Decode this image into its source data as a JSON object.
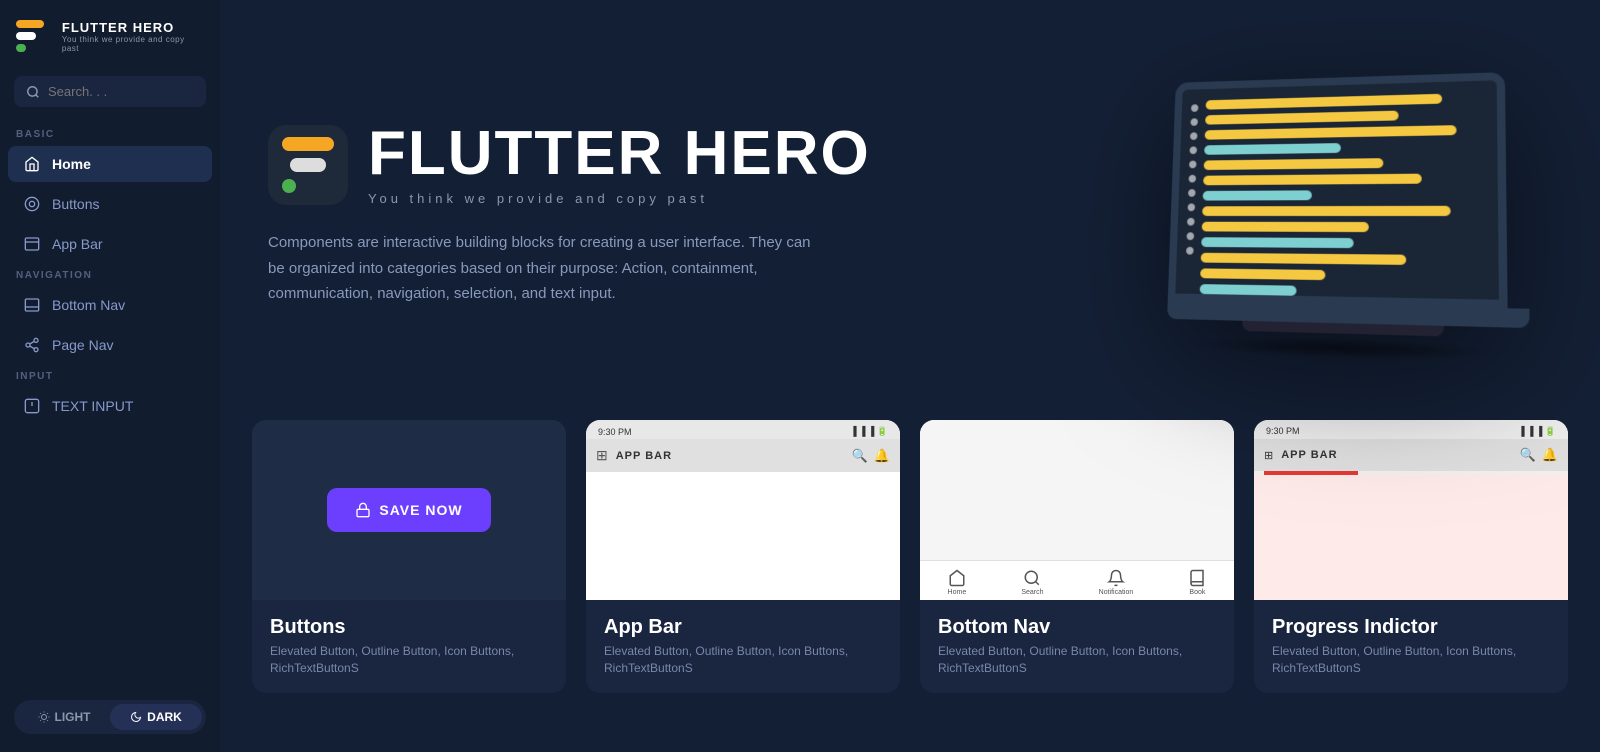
{
  "sidebar": {
    "logo": {
      "title": "FLUTTER HERO",
      "subtitle": "You think we provide and copy past"
    },
    "search": {
      "placeholder": "Search. . ."
    },
    "sections": [
      {
        "label": "BASIC",
        "items": [
          {
            "id": "home",
            "label": "Home",
            "icon": "home-icon",
            "active": true
          },
          {
            "id": "buttons",
            "label": "Buttons",
            "icon": "buttons-icon",
            "active": false
          },
          {
            "id": "app-bar",
            "label": "App Bar",
            "icon": "appbar-icon",
            "active": false
          }
        ]
      },
      {
        "label": "NAVIGATION",
        "items": [
          {
            "id": "bottom-nav",
            "label": "Bottom Nav",
            "icon": "bottomnav-icon",
            "active": false
          },
          {
            "id": "page-nav",
            "label": "Page Nav",
            "icon": "pagenav-icon",
            "active": false
          }
        ]
      },
      {
        "label": "INPUT",
        "items": [
          {
            "id": "text-input",
            "label": "TEXT INPUT",
            "icon": "textinput-icon",
            "active": false
          }
        ]
      }
    ],
    "theme": {
      "light_label": "LIGHT",
      "dark_label": "DARK",
      "active": "dark"
    }
  },
  "hero": {
    "brand_title": "FLUTTER HERO",
    "brand_subtitle": "You think we provide and copy past",
    "description": "Components are interactive building blocks for creating a user interface. They can be organized into categories based on their purpose: Action, containment, communication, navigation, selection, and text input."
  },
  "cards": [
    {
      "id": "buttons",
      "title": "Buttons",
      "desc": "Elevated Button, Outline Button, Icon Buttons, RichTextButtonS",
      "preview_type": "buttons",
      "btn_label": "SAVE NOW"
    },
    {
      "id": "appbar",
      "title": "App Bar",
      "desc": "Elevated Button, Outline Button, Icon Buttons, RichTextButtonS",
      "preview_type": "appbar",
      "status_time": "9:30 PM",
      "bar_title": "APP BAR"
    },
    {
      "id": "bottomnav",
      "title": "Bottom Nav",
      "desc": "Elevated Button, Outline Button, Icon Buttons, RichTextButtonS",
      "preview_type": "bottomnav",
      "nav_items": [
        "Home",
        "Search",
        "Notification",
        "Book"
      ]
    },
    {
      "id": "progress",
      "title": "Progress Indictor",
      "desc": "Elevated Button, Outline Button, Icon Buttons, RichTextButtonS",
      "preview_type": "progress",
      "status_time": "9:30 PM",
      "bar_title": "APP BAR"
    }
  ],
  "colors": {
    "accent_purple": "#6c3fff",
    "accent_orange": "#f5a623",
    "accent_green": "#4caf50",
    "bg_sidebar": "#111c2e",
    "bg_main": "#131f35",
    "bg_card": "#1a2540",
    "text_muted": "#7788aa"
  }
}
